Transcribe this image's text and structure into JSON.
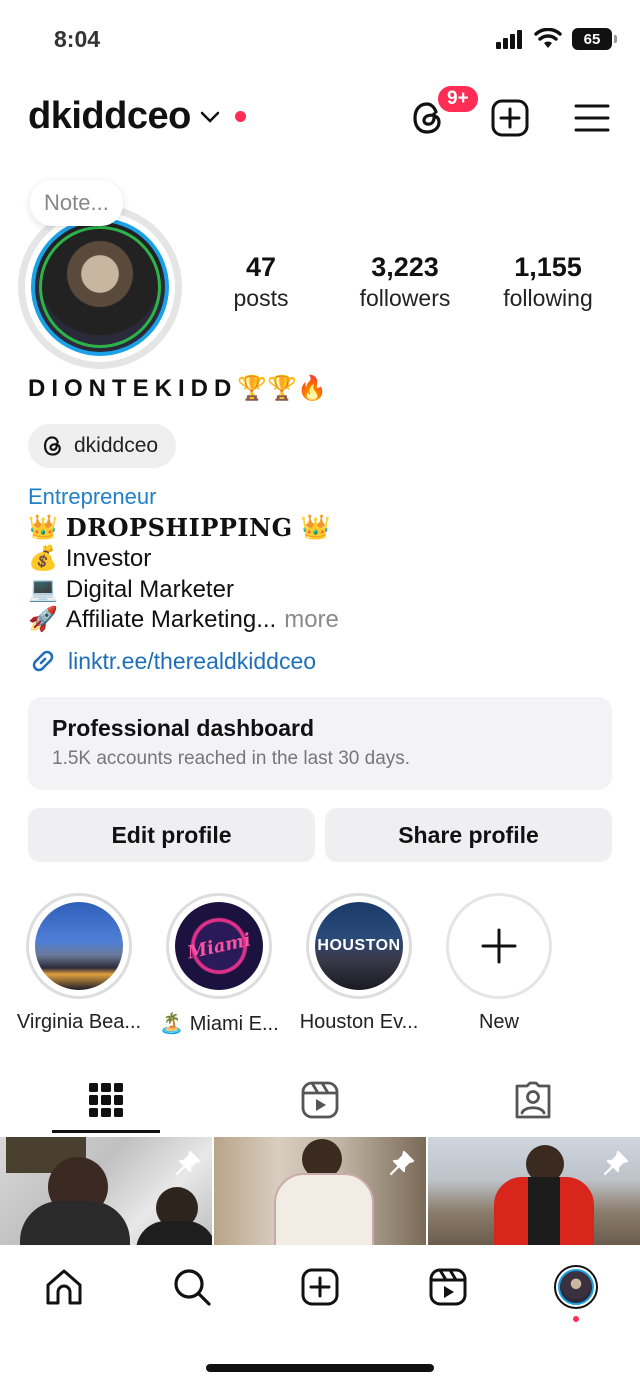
{
  "status": {
    "time": "8:04",
    "battery": "65"
  },
  "header": {
    "username": "dkiddceo",
    "threads_badge": "9+"
  },
  "profile": {
    "note_placeholder": "Note...",
    "stats": [
      {
        "value": "47",
        "label": "posts"
      },
      {
        "value": "3,223",
        "label": "followers"
      },
      {
        "value": "1,155",
        "label": "following"
      }
    ],
    "display_name": "DIONTEKIDD",
    "display_name_emoji": "🏆🏆🔥",
    "threads_handle": "dkiddceo",
    "category": "Entrepreneur",
    "bio": [
      {
        "emoji": "👑",
        "text": "𝐃𝐑𝐎𝐏𝐒𝐇𝐈𝐏𝐏𝐈𝐍𝐆",
        "emoji_after": "👑"
      },
      {
        "emoji": "💰",
        "text": "Investor"
      },
      {
        "emoji": "💻",
        "text": "Digital Marketer"
      },
      {
        "emoji": "🚀",
        "text": "Affiliate Marketing...",
        "more": "more"
      }
    ],
    "link": "linktr.ee/therealdkiddceo"
  },
  "dashboard": {
    "title": "Professional dashboard",
    "subtitle": "1.5K accounts reached in the last 30 days."
  },
  "buttons": {
    "edit": "Edit profile",
    "share": "Share profile"
  },
  "highlights": [
    {
      "label": "Virginia Bea..."
    },
    {
      "label": "🏝️ Miami E..."
    },
    {
      "label": "Houston Ev...",
      "cover_text": "HOUSTON"
    },
    {
      "label": "New"
    }
  ],
  "miami_text": "Miami",
  "colors": {
    "accent_blue": "#1f7fc7",
    "notification_red": "#ff2d55"
  }
}
